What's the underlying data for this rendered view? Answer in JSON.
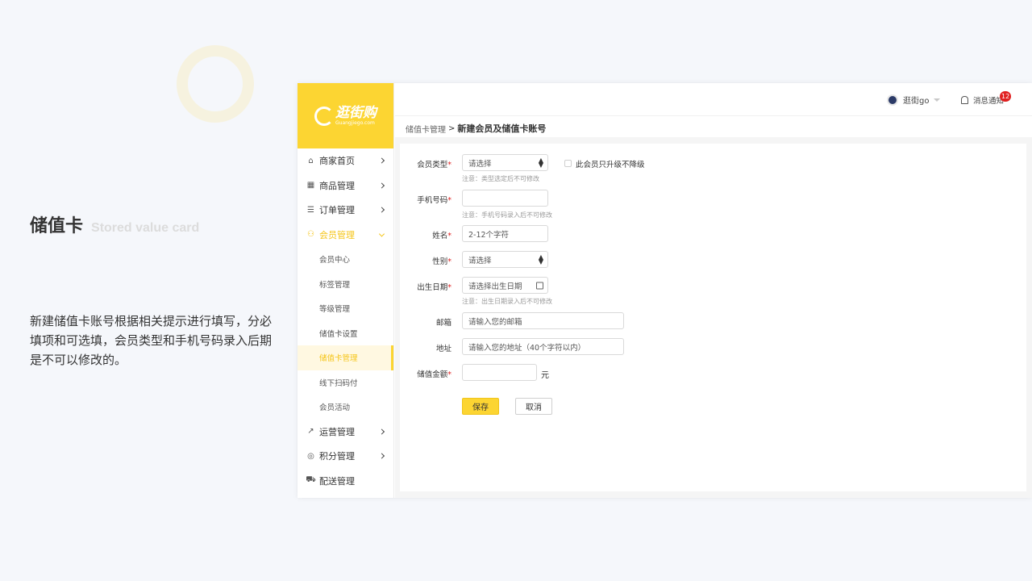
{
  "intro": {
    "title": "储值卡",
    "subtitle": "Stored value card",
    "description": "新建储值卡账号根据相关提示进行填写，分必填项和可选填，会员类型和手机号码录入后期是不可以修改的。"
  },
  "logo": {
    "name": "逛街购",
    "domain": "Guangjiego.com"
  },
  "sidebar": {
    "items": [
      {
        "label": "商家首页",
        "icon": "home-icon"
      },
      {
        "label": "商品管理",
        "icon": "grid-icon"
      },
      {
        "label": "订单管理",
        "icon": "list-icon"
      },
      {
        "label": "会员管理",
        "icon": "users-icon"
      },
      {
        "label": "运营管理",
        "icon": "chart-icon"
      },
      {
        "label": "积分管理",
        "icon": "coins-icon"
      },
      {
        "label": "配送管理",
        "icon": "truck-icon"
      }
    ],
    "sub_items": [
      "会员中心",
      "标签管理",
      "等级管理",
      "储值卡设置",
      "储值卡管理",
      "线下扫码付",
      "会员活动"
    ]
  },
  "header": {
    "user_name": "逛街go",
    "notice_label": "消息通知",
    "notice_count": "12"
  },
  "breadcrumb": {
    "parent": "储值卡管理",
    "sep": ">",
    "current": "新建会员及储值卡账号"
  },
  "form": {
    "member_type_label": "会员类型",
    "member_type_value": "请选择",
    "member_type_hint": "注意：类型选定后不可修改",
    "upgrade_only_label": "此会员只升级不降级",
    "phone_label": "手机号码",
    "phone_value": "",
    "phone_hint": "注意：手机号码录入后不可修改",
    "name_label": "姓名",
    "name_placeholder": "2-12个字符",
    "gender_label": "性别",
    "gender_value": "请选择",
    "birthday_label": "出生日期",
    "birthday_placeholder": "请选择出生日期",
    "birthday_hint": "注意：出生日期录入后不可修改",
    "email_label": "邮箱",
    "email_placeholder": "请输入您的邮箱",
    "address_label": "地址",
    "address_placeholder": "请输入您的地址（40个字符以内）",
    "amount_label": "储值金额",
    "amount_value": "",
    "amount_unit": "元",
    "required_mark": "*",
    "save_label": "保存",
    "cancel_label": "取消"
  }
}
